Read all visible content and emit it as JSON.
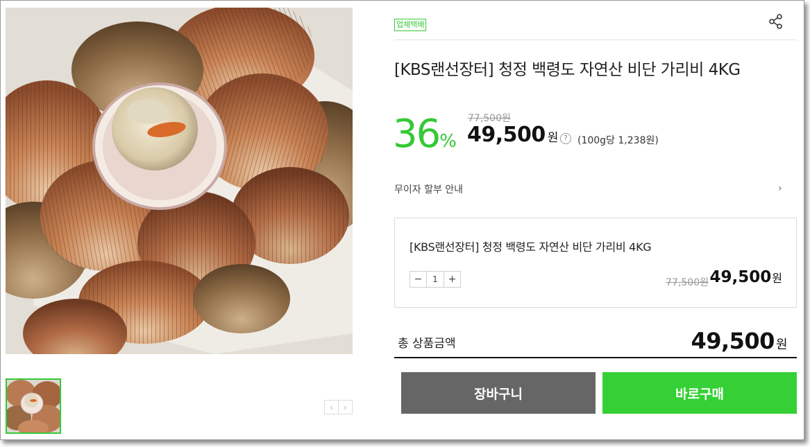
{
  "product": {
    "badge": "업체택배",
    "title": "[KBS랜선장터] 청정 백령도 자연산 비단 가리비 4KG",
    "discount_value": "36",
    "discount_unit": "%",
    "original_price": "77,500원",
    "sale_price": "49,500",
    "currency": "원",
    "help_symbol": "?",
    "unit_price": "(100g당 1,238원)"
  },
  "installment": {
    "label": "무이자 할부 안내",
    "arrow": "›"
  },
  "option": {
    "name": "[KBS랜선장터] 청정 백령도 자연산 비단 가리비 4KG",
    "qty_minus": "−",
    "qty_value": "1",
    "qty_plus": "+",
    "original_price": "77,500원",
    "price": "49,500",
    "currency": "원"
  },
  "total": {
    "label": "총 상품금액",
    "price": "49,500",
    "currency": "원"
  },
  "buttons": {
    "cart": "장바구니",
    "buy": "바로구매"
  },
  "gallery": {
    "prev": "‹",
    "next": "›"
  },
  "colors": {
    "accent": "#35c935",
    "buy_button": "#35d035",
    "cart_button": "#666666"
  },
  "icons": {
    "share": "share-icon",
    "help": "help-icon"
  }
}
